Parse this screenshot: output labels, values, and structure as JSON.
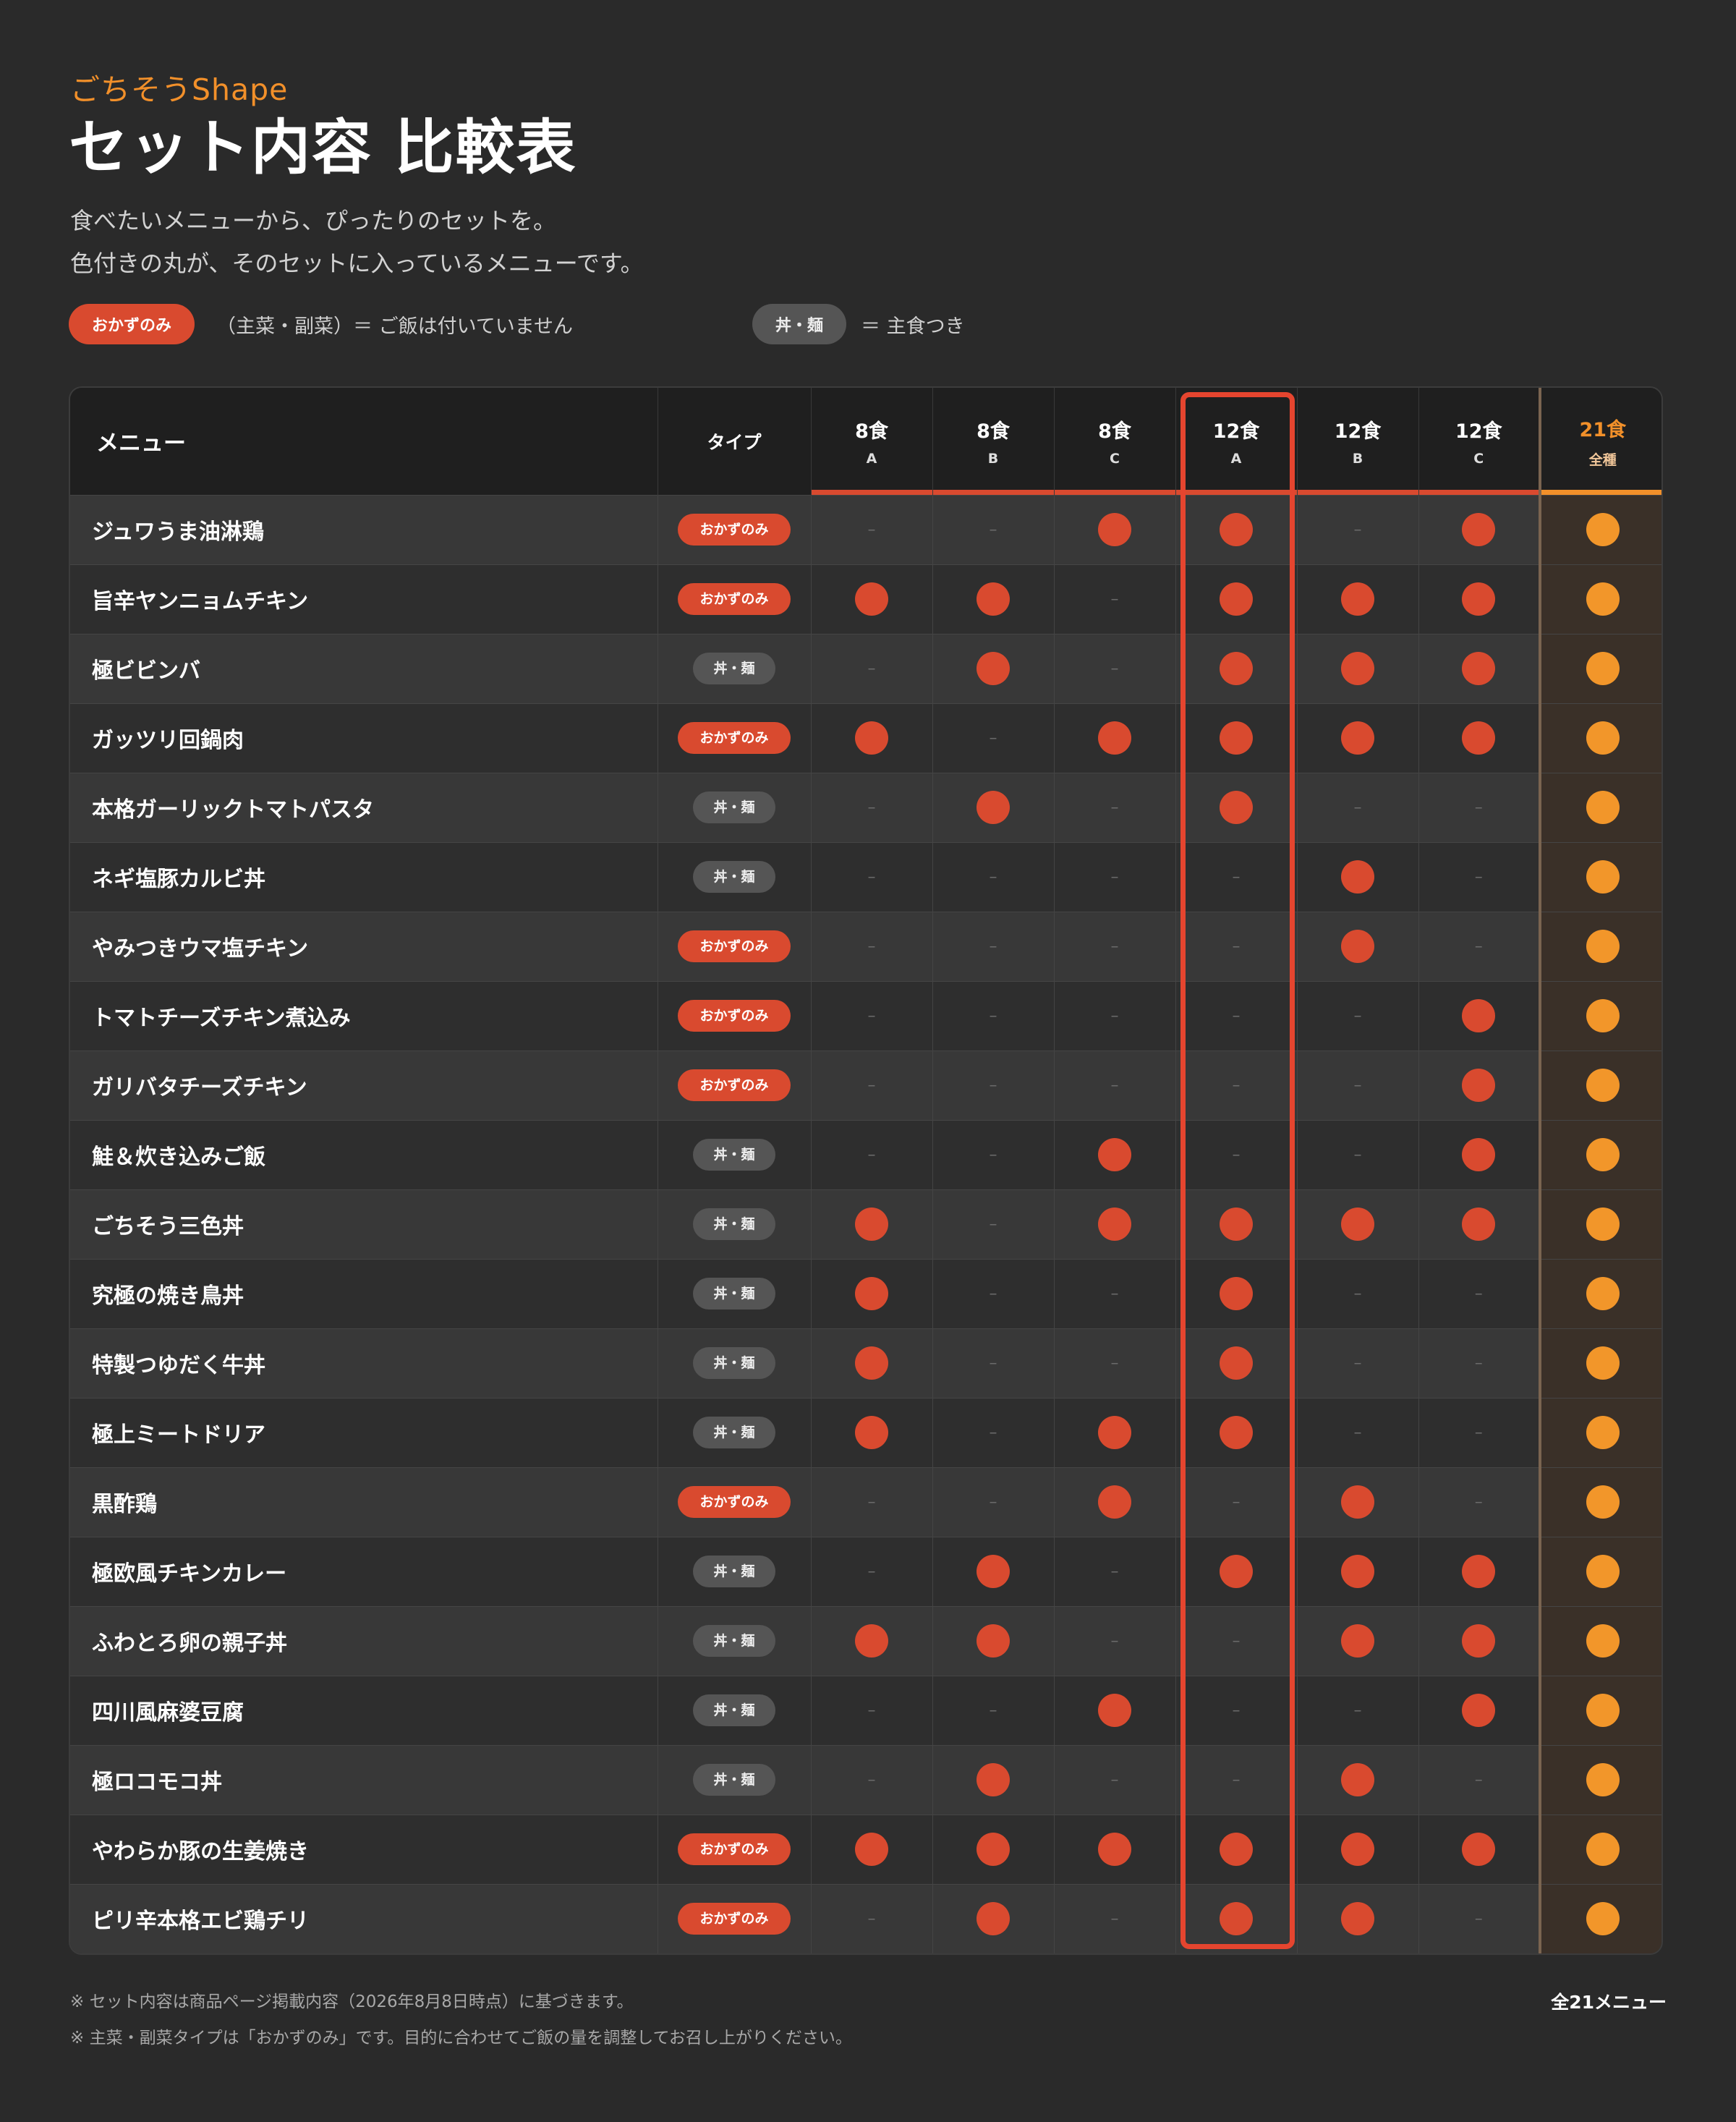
{
  "brand": "ごちそうShape",
  "title": "セット内容 比較表",
  "intro": {
    "line1": "食べたいメニューから、ぴったりのセットを。",
    "line2": "色付きの丸が、そのセットに入っているメニューです。"
  },
  "legend": {
    "okazu_label": "おかずのみ",
    "okazu_text": "（主菜・副菜）＝ ご飯は付いていません",
    "don_label": "丼・麺",
    "don_text": "＝ 主食つき"
  },
  "colors": {
    "accent_red": "#d94a2f",
    "accent_orange": "#f2902a",
    "background": "#2a2a2a"
  },
  "table": {
    "menu_header": "メニュー",
    "type_header": "タイプ",
    "sets": [
      {
        "count": "8食",
        "sub": "A"
      },
      {
        "count": "8食",
        "sub": "B"
      },
      {
        "count": "8食",
        "sub": "C"
      },
      {
        "count": "12食",
        "sub": "A"
      },
      {
        "count": "12食",
        "sub": "B"
      },
      {
        "count": "12食",
        "sub": "C"
      },
      {
        "count": "21食",
        "sub": "全種"
      }
    ],
    "highlighted_set": "12食 A",
    "dash": "–",
    "rows": [
      {
        "name": "ジュワうま油淋鶏",
        "type": "おかずのみ",
        "in": [
          0,
          0,
          1,
          1,
          0,
          1,
          1
        ]
      },
      {
        "name": "旨辛ヤンニョムチキン",
        "type": "おかずのみ",
        "in": [
          1,
          1,
          0,
          1,
          1,
          1,
          1
        ]
      },
      {
        "name": "極ビビンバ",
        "type": "丼・麺",
        "in": [
          0,
          1,
          0,
          1,
          1,
          1,
          1
        ]
      },
      {
        "name": "ガッツリ回鍋肉",
        "type": "おかずのみ",
        "in": [
          1,
          0,
          1,
          1,
          1,
          1,
          1
        ]
      },
      {
        "name": "本格ガーリックトマトパスタ",
        "type": "丼・麺",
        "in": [
          0,
          1,
          0,
          1,
          0,
          0,
          1
        ]
      },
      {
        "name": "ネギ塩豚カルビ丼",
        "type": "丼・麺",
        "in": [
          0,
          0,
          0,
          0,
          1,
          0,
          1
        ]
      },
      {
        "name": "やみつきウマ塩チキン",
        "type": "おかずのみ",
        "in": [
          0,
          0,
          0,
          0,
          1,
          0,
          1
        ]
      },
      {
        "name": "トマトチーズチキン煮込み",
        "type": "おかずのみ",
        "in": [
          0,
          0,
          0,
          0,
          0,
          1,
          1
        ]
      },
      {
        "name": "ガリバタチーズチキン",
        "type": "おかずのみ",
        "in": [
          0,
          0,
          0,
          0,
          0,
          1,
          1
        ]
      },
      {
        "name": "鮭＆炊き込みご飯",
        "type": "丼・麺",
        "in": [
          0,
          0,
          1,
          0,
          0,
          1,
          1
        ]
      },
      {
        "name": "ごちそう三色丼",
        "type": "丼・麺",
        "in": [
          1,
          0,
          1,
          1,
          1,
          1,
          1
        ]
      },
      {
        "name": "究極の焼き鳥丼",
        "type": "丼・麺",
        "in": [
          1,
          0,
          0,
          1,
          0,
          0,
          1
        ]
      },
      {
        "name": "特製つゆだく牛丼",
        "type": "丼・麺",
        "in": [
          1,
          0,
          0,
          1,
          0,
          0,
          1
        ]
      },
      {
        "name": "極上ミートドリア",
        "type": "丼・麺",
        "in": [
          1,
          0,
          1,
          1,
          0,
          0,
          1
        ]
      },
      {
        "name": "黒酢鶏",
        "type": "おかずのみ",
        "in": [
          0,
          0,
          1,
          0,
          1,
          0,
          1
        ]
      },
      {
        "name": "極欧風チキンカレー",
        "type": "丼・麺",
        "in": [
          0,
          1,
          0,
          1,
          1,
          1,
          1
        ]
      },
      {
        "name": "ふわとろ卵の親子丼",
        "type": "丼・麺",
        "in": [
          1,
          1,
          0,
          0,
          1,
          1,
          1
        ]
      },
      {
        "name": "四川風麻婆豆腐",
        "type": "丼・麺",
        "in": [
          0,
          0,
          1,
          0,
          0,
          1,
          1
        ]
      },
      {
        "name": "極ロコモコ丼",
        "type": "丼・麺",
        "in": [
          0,
          1,
          0,
          0,
          1,
          0,
          1
        ]
      },
      {
        "name": "やわらか豚の生姜焼き",
        "type": "おかずのみ",
        "in": [
          1,
          1,
          1,
          1,
          1,
          1,
          1
        ]
      },
      {
        "name": "ピリ辛本格エビ鶏チリ",
        "type": "おかずのみ",
        "in": [
          0,
          1,
          0,
          1,
          1,
          0,
          1
        ]
      }
    ]
  },
  "footer": {
    "note1": "※ セット内容は商品ページ掲載内容（2026年8月8日時点）に基づきます。",
    "note2": "※ 主菜・副菜タイプは「おかずのみ」です。目的に合わせてご飯の量を調整してお召し上がりください。",
    "total": "全21メニュー"
  }
}
